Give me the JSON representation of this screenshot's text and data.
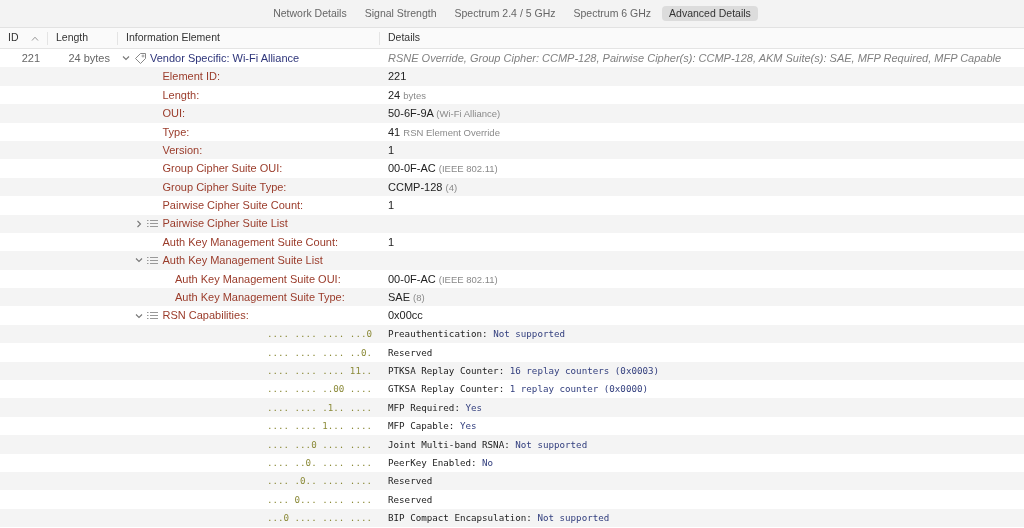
{
  "tabs": [
    {
      "label": "Network Details",
      "selected": false
    },
    {
      "label": "Signal Strength",
      "selected": false
    },
    {
      "label": "Spectrum 2.4 / 5 GHz",
      "selected": false
    },
    {
      "label": "Spectrum 6 GHz",
      "selected": false
    },
    {
      "label": "Advanced Details",
      "selected": true
    }
  ],
  "columns": [
    {
      "label": "ID",
      "sorted": true
    },
    {
      "label": "Length",
      "sorted": false
    },
    {
      "label": "Information Element",
      "sorted": false
    },
    {
      "label": "Details",
      "sorted": false
    }
  ],
  "rows": [
    {
      "id": "221",
      "length": "24 bytes",
      "name": "Vendor Specific: Wi-Fi Alliance",
      "details": "RSNE Override, Group Cipher: CCMP-128, Pairwise Cipher(s): CCMP-128, AKM Suite(s): SAE, MFP Required, MFP Capable",
      "expanded": true,
      "children": [
        {
          "kind": "field",
          "label": "Element ID:",
          "value": "221"
        },
        {
          "kind": "field",
          "label": "Length:",
          "value": "24",
          "note": "bytes"
        },
        {
          "kind": "field",
          "label": "OUI:",
          "value": "50-6F-9A",
          "note": "(Wi-Fi Alliance)"
        },
        {
          "kind": "field",
          "label": "Type:",
          "value": "41",
          "note": "RSN Element Override"
        },
        {
          "kind": "field",
          "label": "Version:",
          "value": "1"
        },
        {
          "kind": "field",
          "label": "Group Cipher Suite OUI:",
          "value": "00-0F-AC",
          "note": "(IEEE 802.11)"
        },
        {
          "kind": "field",
          "label": "Group Cipher Suite Type:",
          "value": "CCMP-128",
          "note": "(4)"
        },
        {
          "kind": "field",
          "label": "Pairwise Cipher Suite Count:",
          "value": "1"
        },
        {
          "kind": "list",
          "label": "Pairwise Cipher Suite List",
          "expanded": false
        },
        {
          "kind": "field",
          "label": "Auth Key Management Suite Count:",
          "value": "1"
        },
        {
          "kind": "list",
          "label": "Auth Key Management Suite List",
          "expanded": true,
          "children": [
            {
              "kind": "field",
              "label": "Auth Key Management Suite OUI:",
              "value": "00-0F-AC",
              "note": "(IEEE 802.11)"
            },
            {
              "kind": "field",
              "label": "Auth Key Management Suite Type:",
              "value": "SAE",
              "note": "(8)"
            }
          ]
        },
        {
          "kind": "list",
          "label": "RSN Capabilities:",
          "value": "0x00cc",
          "expanded": true,
          "children": [
            {
              "kind": "bits",
              "bits": ".... .... .... ...0",
              "label": "Preauthentication:",
              "value": "Not supported"
            },
            {
              "kind": "bits",
              "bits": ".... .... .... ..0.",
              "label": "Reserved"
            },
            {
              "kind": "bits",
              "bits": ".... .... .... 11..",
              "label": "PTKSA Replay Counter:",
              "value": "16 replay counters (0x0003)"
            },
            {
              "kind": "bits",
              "bits": ".... .... ..00 ....",
              "label": "GTKSA Replay Counter:",
              "value": "1 replay counter (0x0000)"
            },
            {
              "kind": "bits",
              "bits": ".... .... .1.. ....",
              "label": "MFP Required:",
              "value": "Yes"
            },
            {
              "kind": "bits",
              "bits": ".... .... 1... ....",
              "label": "MFP Capable:",
              "value": "Yes"
            },
            {
              "kind": "bits",
              "bits": ".... ...0 .... ....",
              "label": "Joint Multi-band RSNA:",
              "value": "Not supported"
            },
            {
              "kind": "bits",
              "bits": ".... ..0. .... ....",
              "label": "PeerKey Enabled:",
              "value": "No"
            },
            {
              "kind": "bits",
              "bits": ".... .0.. .... ....",
              "label": "Reserved"
            },
            {
              "kind": "bits",
              "bits": ".... 0... .... ....",
              "label": "Reserved"
            },
            {
              "kind": "bits",
              "bits": "...0 .... .... ....",
              "label": "BIP Compact Encapsulation:",
              "value": "Not supported"
            }
          ]
        }
      ]
    }
  ]
}
